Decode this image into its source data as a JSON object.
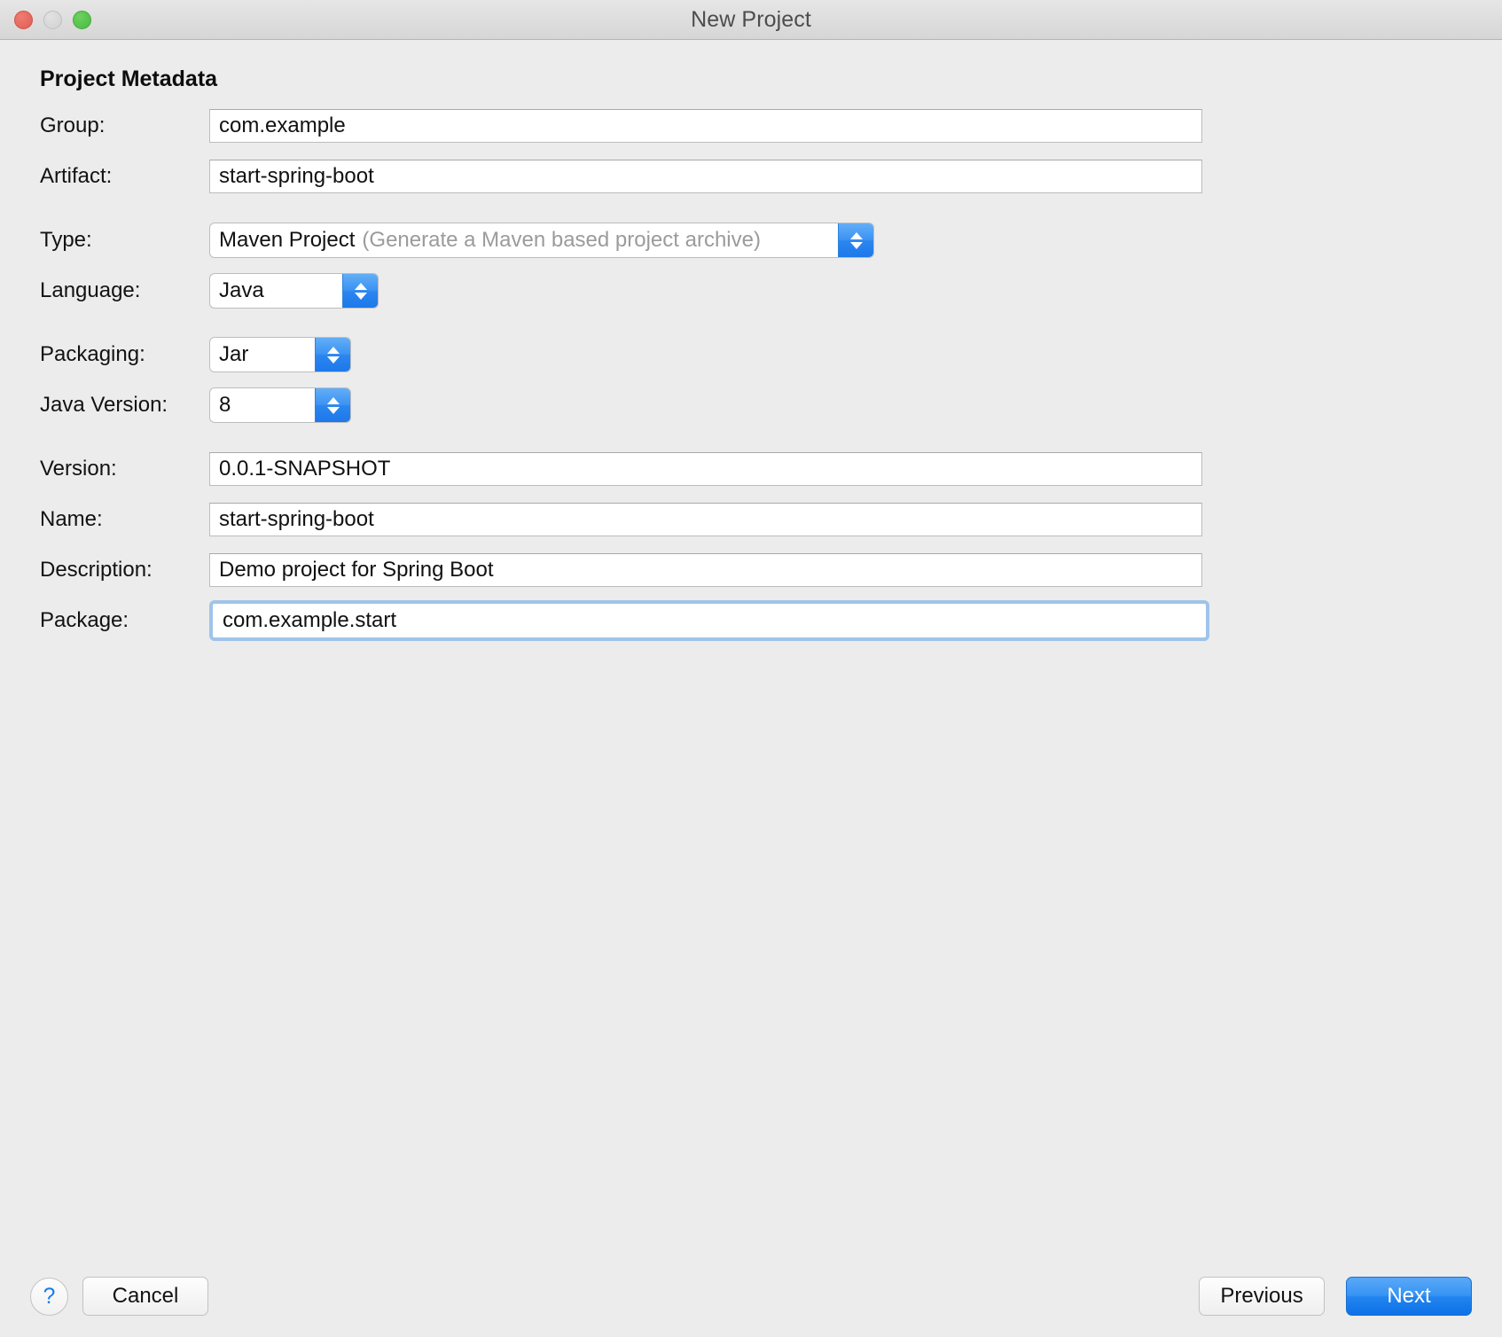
{
  "window": {
    "title": "New Project",
    "traffic_lights": [
      "close",
      "minimize",
      "maximize"
    ]
  },
  "section": {
    "title": "Project Metadata"
  },
  "fields": {
    "group": {
      "label": "Group:",
      "value": "com.example"
    },
    "artifact": {
      "label": "Artifact:",
      "value": "start-spring-boot"
    },
    "type": {
      "label": "Type:",
      "value": "Maven Project",
      "hint": "(Generate a Maven based project archive)"
    },
    "language": {
      "label": "Language:",
      "value": "Java"
    },
    "packaging": {
      "label": "Packaging:",
      "value": "Jar"
    },
    "java_version": {
      "label": "Java Version:",
      "value": "8"
    },
    "version": {
      "label": "Version:",
      "value": "0.0.1-SNAPSHOT"
    },
    "name": {
      "label": "Name:",
      "value": "start-spring-boot"
    },
    "description": {
      "label": "Description:",
      "value": "Demo project for Spring Boot"
    },
    "package": {
      "label": "Package:",
      "value": "com.example.start",
      "focused": true
    }
  },
  "footer": {
    "help_label": "?",
    "cancel_label": "Cancel",
    "previous_label": "Previous",
    "next_label": "Next"
  },
  "colors": {
    "accent_blue": "#2285f0",
    "focus_ring": "#9fc4ea",
    "help_glyph": "#1a7ced",
    "window_bg": "#ececec",
    "hint_text": "#9b9b9b"
  }
}
